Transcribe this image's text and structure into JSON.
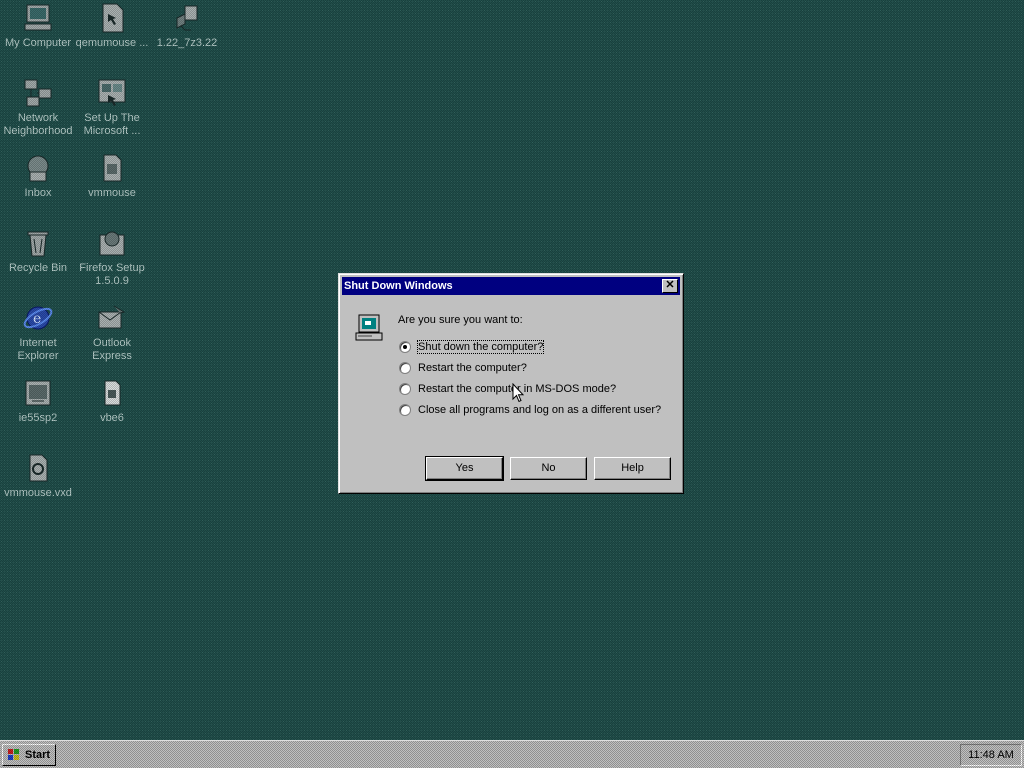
{
  "desktop": {
    "icons": [
      {
        "label": "My Computer",
        "label2": ""
      },
      {
        "label": "qemumouse ...",
        "label2": ""
      },
      {
        "label": "1.22_7z3.22",
        "label2": ""
      },
      {
        "label": "Network",
        "label2": "Neighborhood"
      },
      {
        "label": "Set Up The",
        "label2": "Microsoft ..."
      },
      {
        "label": "Inbox",
        "label2": ""
      },
      {
        "label": "vmmouse",
        "label2": ""
      },
      {
        "label": "Recycle Bin",
        "label2": ""
      },
      {
        "label": "Firefox Setup",
        "label2": "1.5.0.9"
      },
      {
        "label": "Internet",
        "label2": "Explorer"
      },
      {
        "label": "Outlook",
        "label2": "Express"
      },
      {
        "label": "ie55sp2",
        "label2": ""
      },
      {
        "label": "vbe6",
        "label2": ""
      },
      {
        "label": "vmmouse.vxd",
        "label2": ""
      }
    ]
  },
  "dialog": {
    "title": "Shut Down Windows",
    "close_glyph": "✕",
    "prompt": "Are you sure you want to:",
    "options": [
      {
        "label": "Shut down the computer?",
        "checked": true
      },
      {
        "label": "Restart the computer?",
        "checked": false
      },
      {
        "label": "Restart the computer in MS-DOS mode?",
        "checked": false
      },
      {
        "label": "Close all programs and log on as a different user?",
        "checked": false
      }
    ],
    "buttons": {
      "yes": "Yes",
      "no": "No",
      "help": "Help"
    }
  },
  "taskbar": {
    "start_label": "Start",
    "clock": "11:48 AM"
  },
  "colors": {
    "desktop": "#204e4a",
    "titlebar": "#000080",
    "face": "#c0c0c0"
  }
}
